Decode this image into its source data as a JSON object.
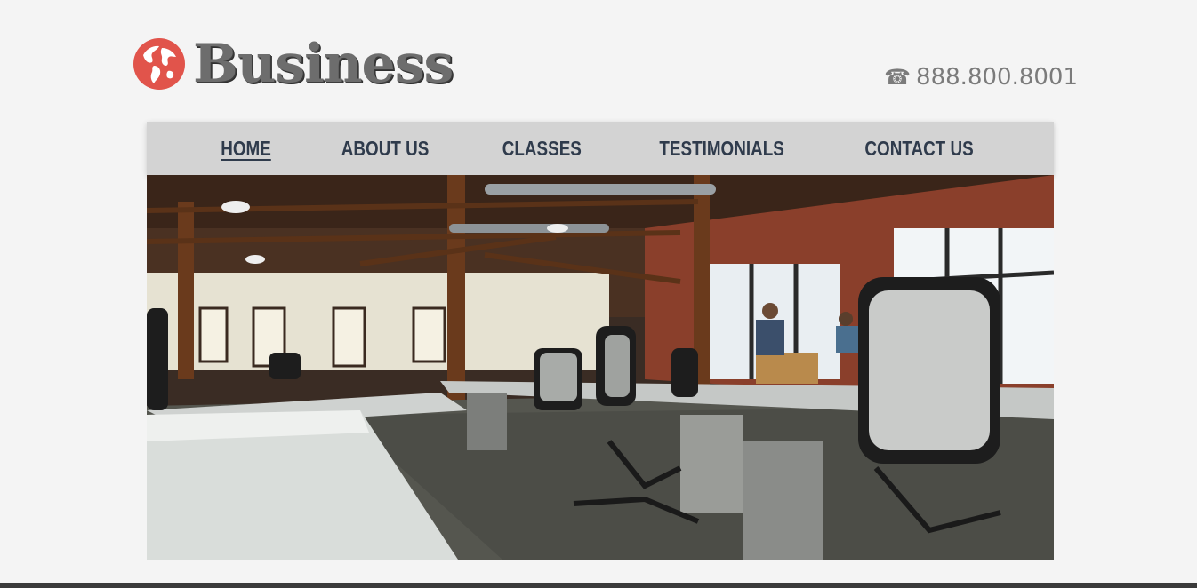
{
  "brand": {
    "name": "Business",
    "logo_icon": "globe-icon",
    "accent": "#e1544b"
  },
  "header": {
    "phone_icon": "telephone-icon",
    "phone": "888.800.8001"
  },
  "nav": {
    "items": [
      {
        "label": "HOME",
        "active": true
      },
      {
        "label": "ABOUT US"
      },
      {
        "label": "CLASSES"
      },
      {
        "label": "TESTIMONIALS"
      },
      {
        "label": "CONTACT US"
      }
    ]
  },
  "hero": {
    "image": "office-interior-photo"
  }
}
